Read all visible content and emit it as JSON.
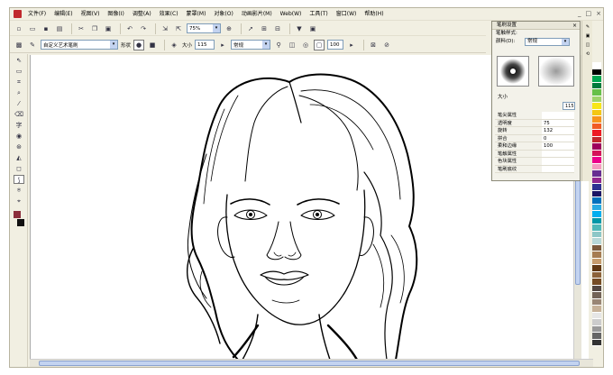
{
  "menubar": {
    "items": [
      "文件(F)",
      "编辑(E)",
      "视图(V)",
      "图像(I)",
      "调整(A)",
      "效果(C)",
      "蒙罩(M)",
      "对象(O)",
      "动画影片(M)",
      "Web(W)",
      "工具(T)",
      "窗口(W)",
      "帮助(H)"
    ],
    "window_controls": [
      "_",
      "□",
      "×"
    ]
  },
  "toolbar1": {
    "zoom": "75%"
  },
  "toolbar2": {
    "brush_name": "自定义艺术笔刷",
    "shape_label": "形状",
    "size_label": "大小",
    "size_value": "115",
    "mode": "常规",
    "opacity_value": "100"
  },
  "panel": {
    "title": "笔刷设置",
    "style_label": "笔触样式:",
    "color_label": "颜料(D):",
    "color_mode": "常规",
    "size_label": "大小",
    "size_value": "115",
    "props": [
      {
        "k": "笔尖属性",
        "v": ""
      },
      {
        "k": "透明度",
        "v": "75"
      },
      {
        "k": "旋转",
        "v": "132"
      },
      {
        "k": "拼合",
        "v": "0"
      },
      {
        "k": "柔和边缘",
        "v": "100"
      },
      {
        "k": "笔触属性",
        "v": ""
      },
      {
        "k": "色块属性",
        "v": ""
      },
      {
        "k": "笔刷底纹",
        "v": ""
      }
    ]
  },
  "colors": {
    "palette": [
      "#ffffff",
      "#000000",
      "#00a651",
      "#007a3d",
      "#66c048",
      "#9ed36a",
      "#f7e619",
      "#f4c715",
      "#f7941d",
      "#f15a24",
      "#ed1c24",
      "#c1272d",
      "#9e005d",
      "#d4145a",
      "#ec008c",
      "#f49ac1",
      "#662d91",
      "#92278f",
      "#2e3192",
      "#1b1464",
      "#0071bc",
      "#29abe2",
      "#00aeef",
      "#0097a7",
      "#4fb8b8",
      "#8dc7c7",
      "#b8d8d8",
      "#7c5a3c",
      "#a67c52",
      "#c69c6d",
      "#603813",
      "#8c6239",
      "#754c24",
      "#534741",
      "#736357",
      "#998675",
      "#c7b299",
      "#e6e6e6",
      "#cccccc",
      "#999999",
      "#666666",
      "#333333"
    ]
  }
}
